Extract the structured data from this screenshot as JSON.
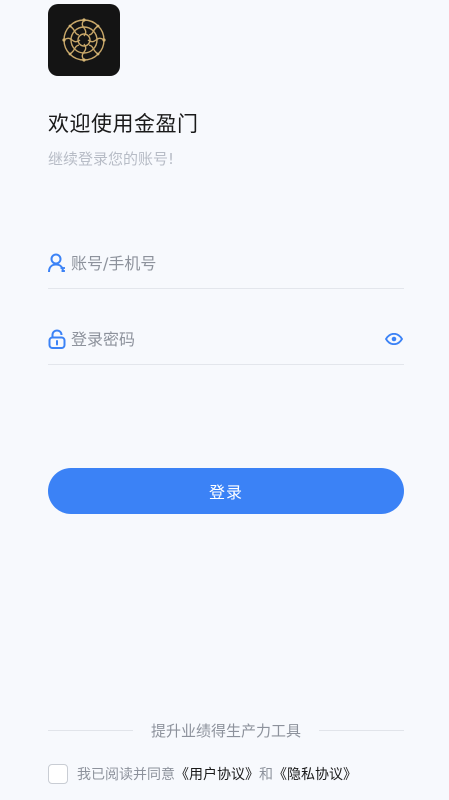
{
  "brand": {
    "logo_icon": "gold-filigree-logo-icon",
    "accent": "#3b82f6"
  },
  "header": {
    "title": "欢迎使用金盈门",
    "subtitle": "继续登录您的账号!"
  },
  "form": {
    "account": {
      "icon": "user-icon",
      "placeholder": "账号/手机号",
      "value": ""
    },
    "password": {
      "icon": "lock-icon",
      "placeholder": "登录密码",
      "value": "",
      "toggle_icon": "eye-icon"
    },
    "login_label": "登录"
  },
  "footer": {
    "slogan": "提升业绩得生产力工具",
    "agree_text": "我已阅读并同意",
    "user_agreement": "《用户协议》",
    "and_text": "和",
    "privacy_agreement": "《隐私协议》",
    "checked": false
  }
}
